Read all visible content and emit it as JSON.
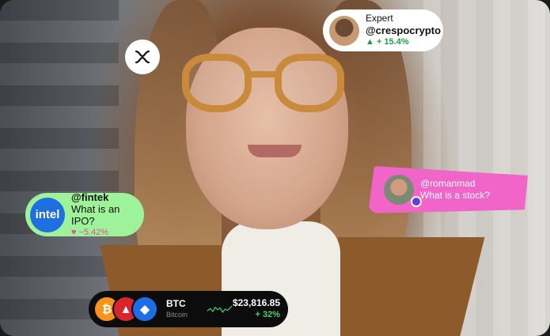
{
  "expert_card": {
    "title": "Expert",
    "handle": "@crespocrypto",
    "change": "▲ + 15.4%"
  },
  "fintek_card": {
    "logo_text": "intel",
    "handle": "@fintek",
    "message": "What is an IPO?",
    "change": "♥ −5.42%"
  },
  "roman_card": {
    "handle": "@romanmad",
    "message": "What is a stock?"
  },
  "btc_bar": {
    "coin_icons": [
      "bitcoin-icon",
      "tron-icon",
      "arbitrum-icon"
    ],
    "symbol": "BTC",
    "name": "Bitcoin",
    "price": "$23,816.85",
    "change": "+ 32%"
  },
  "colors": {
    "expert_bg": "#ffffff",
    "fintek_bg": "#9ef29a",
    "roman_bg": "#f165c9",
    "btc_bg": "#0c0c0c",
    "positive": "#1f9d4c",
    "negative": "#e0508f",
    "spark": "#3ecf6a"
  }
}
